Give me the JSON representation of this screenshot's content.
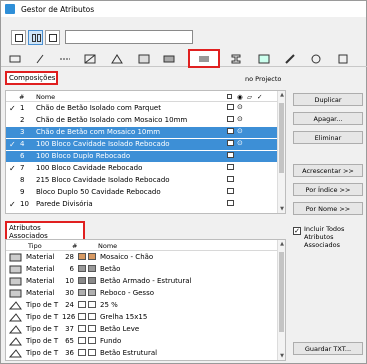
{
  "window": {
    "title": "Gestor de Atributos"
  },
  "filter": {
    "value": ""
  },
  "compositions": {
    "label": "Composições",
    "project_label": "no Projecto",
    "col_num": "#",
    "col_name": "Nome",
    "rows": [
      {
        "check": "✓",
        "num": "1",
        "name": "Chão de Betão Isolado com Parquet",
        "hl": false
      },
      {
        "check": "",
        "num": "2",
        "name": "Chão de Betão Isolado com Mosaico 10mm",
        "hl": false
      },
      {
        "check": "",
        "num": "3",
        "name": "Chão de Betão com Mosaico 10mm",
        "hl": true
      },
      {
        "check": "✓",
        "num": "4",
        "name": "100 Bloco Cavidade Isolado Rebocado",
        "hl": true
      },
      {
        "check": "",
        "num": "6",
        "name": "100 Bloco Duplo Rebocado",
        "hl": true
      },
      {
        "check": "✓",
        "num": "7",
        "name": "100 Bloco Cavidade Rebocado",
        "hl": false
      },
      {
        "check": "",
        "num": "8",
        "name": "215 Bloco Cavidade Isolado Rebocado",
        "hl": false
      },
      {
        "check": "",
        "num": "9",
        "name": "Bloco Duplo 50 Cavidade Rebocado",
        "hl": false
      },
      {
        "check": "✓",
        "num": "10",
        "name": "Parede Divisória",
        "hl": false
      }
    ]
  },
  "buttons": {
    "duplicate": "Duplicar",
    "delete": "Apagar...",
    "remove": "Eliminar",
    "append": "Acrescentar >>",
    "by_index": "Por Índice >>",
    "by_name": "Por Nome >>",
    "save_txt": "Guardar TXT..."
  },
  "include_all": {
    "label": "Incluir Todos Atributos Associados",
    "checked": true
  },
  "associated": {
    "label": "Atributos Associados",
    "col_type": "Tipo",
    "col_num": "#",
    "col_name": "Nome",
    "rows": [
      {
        "type": "Material",
        "num": "28",
        "name": "Mosaico - Chão",
        "color": "#d89a63"
      },
      {
        "type": "Material",
        "num": "6",
        "name": "Betão",
        "color": "#9a9a9a"
      },
      {
        "type": "Material",
        "num": "10",
        "name": "Betão Armado - Estrutural",
        "color": "#8a8a8a"
      },
      {
        "type": "Material",
        "num": "30",
        "name": "Reboco - Gesso",
        "color": "#b0b0b0"
      },
      {
        "type": "Tipo de T",
        "num": "24",
        "name": "25 %",
        "color": "#ffffff"
      },
      {
        "type": "Tipo de T",
        "num": "126",
        "name": "Grelha 15x15",
        "color": "#ffffff"
      },
      {
        "type": "Tipo de T",
        "num": "37",
        "name": "Betão Leve",
        "color": "#ffffff"
      },
      {
        "type": "Tipo de T",
        "num": "65",
        "name": "Fundo",
        "color": "#ffffff"
      },
      {
        "type": "Tipo de T",
        "num": "36",
        "name": "Betão Estrutural",
        "color": "#ffffff"
      }
    ]
  }
}
